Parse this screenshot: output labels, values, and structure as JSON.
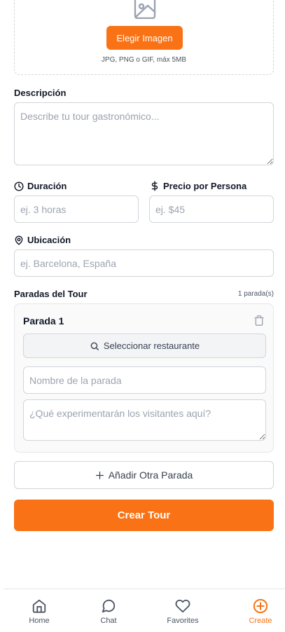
{
  "upload": {
    "button_label": "Elegir Imagen",
    "hint": "JPG, PNG o GIF, máx 5MB"
  },
  "description": {
    "label": "Descripción",
    "placeholder": "Describe tu tour gastronómico..."
  },
  "duration": {
    "label": "Duración",
    "placeholder": "ej. 3 horas"
  },
  "price": {
    "label": "Precio por Persona",
    "placeholder": "ej. $45"
  },
  "location": {
    "label": "Ubicación",
    "placeholder": "ej. Barcelona, España"
  },
  "stops": {
    "title": "Paradas del Tour",
    "count": "1 parada(s)",
    "items": [
      {
        "title": "Parada 1",
        "select_restaurant_label": "Seleccionar restaurante",
        "name_placeholder": "Nombre de la parada",
        "experience_placeholder": "¿Qué experimentarán los visitantes aquí?"
      }
    ],
    "add_label": "Añadir Otra Parada"
  },
  "create_button": "Crear Tour",
  "nav": {
    "items": [
      {
        "label": "Home",
        "icon": "home-icon"
      },
      {
        "label": "Chat",
        "icon": "chat-icon"
      },
      {
        "label": "Favorites",
        "icon": "heart-icon"
      },
      {
        "label": "Create",
        "icon": "plus-circle-icon"
      }
    ],
    "active": "Create"
  },
  "colors": {
    "accent": "#f97316",
    "border": "#d1d5db",
    "muted_text": "#9ca3af"
  }
}
